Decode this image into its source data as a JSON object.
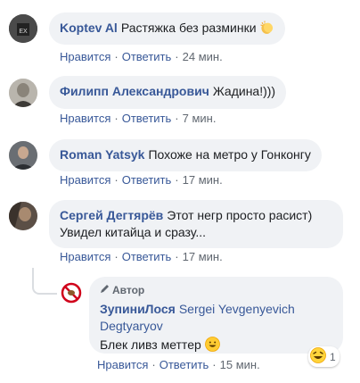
{
  "comments": [
    {
      "author": "Koptev Al",
      "text": "Растяжка без разминки",
      "emoji": "clapping-hands",
      "actions": {
        "like": "Нравится",
        "reply": "Ответить",
        "time": "24 мин."
      }
    },
    {
      "author": "Филипп Александрович",
      "text": "Жадина!)))",
      "actions": {
        "like": "Нравится",
        "reply": "Ответить",
        "time": "7 мин."
      }
    },
    {
      "author": "Roman Yatsyk",
      "text": "Похоже на метро у Гонконгу",
      "actions": {
        "like": "Нравится",
        "reply": "Ответить",
        "time": "17 мин."
      }
    },
    {
      "author": "Сергей Дегтярёв",
      "text": "Этот негр просто расист) Увидел китайца и сразу...",
      "actions": {
        "like": "Нравится",
        "reply": "Ответить",
        "time": "17 мин."
      }
    }
  ],
  "reply": {
    "badge": "Автор",
    "author": "ЗупиниЛося",
    "mention": "Sergei Yevgenyevich Degtyaryov",
    "text": "Блек ливз меттер",
    "emoji": "grinning-face",
    "reaction": {
      "emoji": "laughing-face",
      "count": "1"
    },
    "actions": {
      "like": "Нравится",
      "reply": "Ответить",
      "time": "15 мин."
    }
  },
  "separator": "·"
}
